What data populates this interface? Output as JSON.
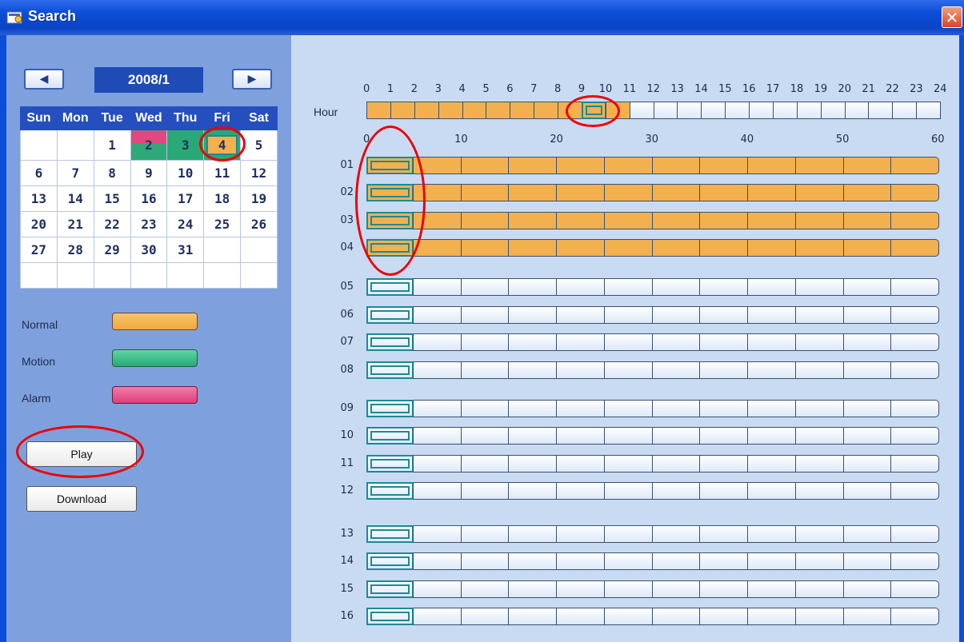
{
  "window": {
    "title": "Search",
    "close_label": "✕"
  },
  "calendar": {
    "prev_label": "◀",
    "next_label": "▶",
    "month": "2008/1",
    "weekdays": [
      "Sun",
      "Mon",
      "Tue",
      "Wed",
      "Thu",
      "Fri",
      "Sat"
    ],
    "weeks": [
      [
        "",
        "",
        "1",
        "2",
        "3",
        "4",
        "5"
      ],
      [
        "6",
        "7",
        "8",
        "9",
        "10",
        "11",
        "12"
      ],
      [
        "13",
        "14",
        "15",
        "16",
        "17",
        "18",
        "19"
      ],
      [
        "20",
        "21",
        "22",
        "23",
        "24",
        "25",
        "26"
      ],
      [
        "27",
        "28",
        "29",
        "30",
        "31",
        "",
        ""
      ],
      [
        "",
        "",
        "",
        "",
        "",
        "",
        ""
      ]
    ],
    "marked_days": {
      "2": "alarm",
      "3": "motion",
      "4": "normal-selected"
    }
  },
  "legend": {
    "normal": "Normal",
    "motion": "Motion",
    "alarm": "Alarm",
    "colors": {
      "normal": "#f2b14e",
      "motion": "#2ea97a",
      "alarm": "#e0487f"
    }
  },
  "buttons": {
    "play": "Play",
    "download": "Download"
  },
  "timeline": {
    "hour_label": "Hour",
    "hour_ticks": [
      "0",
      "1",
      "2",
      "3",
      "4",
      "5",
      "6",
      "7",
      "8",
      "9",
      "10",
      "11",
      "12",
      "13",
      "14",
      "15",
      "16",
      "17",
      "18",
      "19",
      "20",
      "21",
      "22",
      "23",
      "24"
    ],
    "hours_with_recording": [
      0,
      1,
      2,
      3,
      4,
      5,
      6,
      7,
      8,
      9,
      10
    ],
    "selected_hour": 9,
    "minute_ticks": [
      "0",
      "10",
      "20",
      "30",
      "40",
      "50",
      "60"
    ],
    "channels": [
      "01",
      "02",
      "03",
      "04",
      "05",
      "06",
      "07",
      "08",
      "09",
      "10",
      "11",
      "12",
      "13",
      "14",
      "15",
      "16"
    ],
    "channels_with_recording": [
      "01",
      "02",
      "03",
      "04"
    ]
  }
}
